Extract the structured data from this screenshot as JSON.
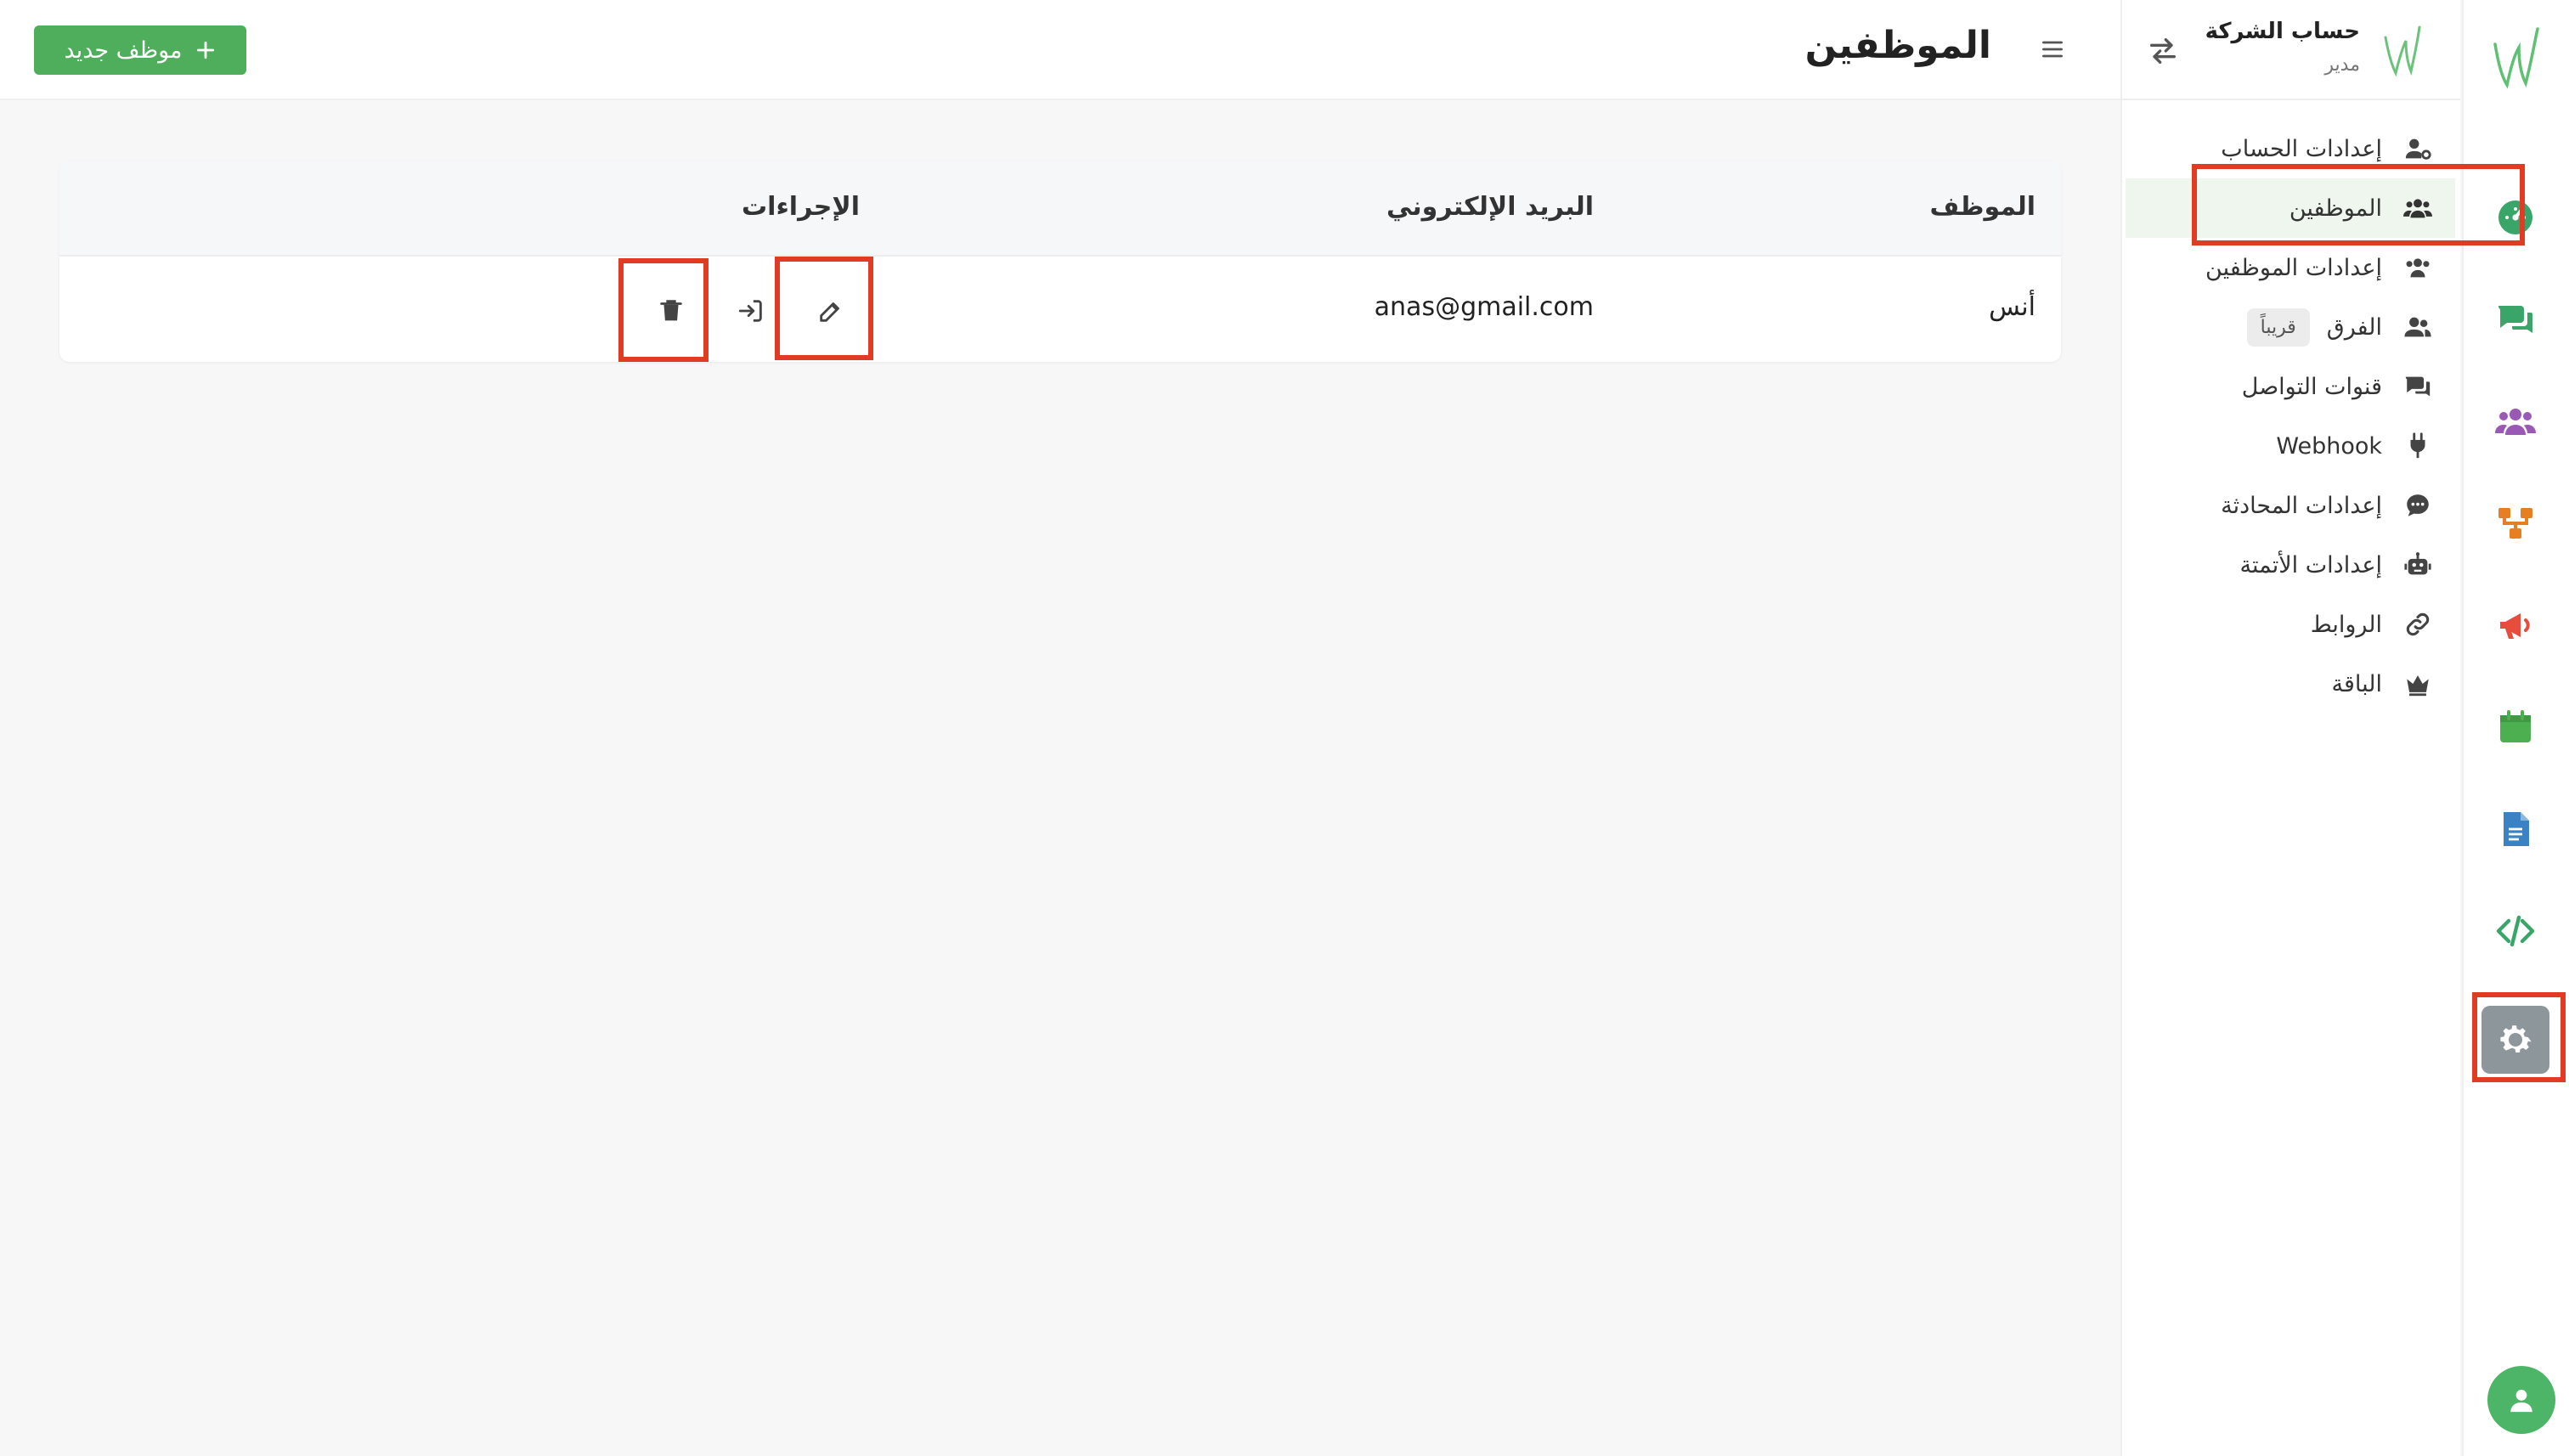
{
  "topbar": {
    "title": "الموظفين",
    "new_button": "موظف جديد"
  },
  "company": {
    "name": "حساب الشركة",
    "role": "مدير"
  },
  "sidebar": {
    "items": [
      {
        "label": "إعدادات الحساب",
        "icon": "user-gear-icon"
      },
      {
        "label": "الموظفين",
        "icon": "users-icon",
        "active": true
      },
      {
        "label": "إعدادات الموظفين",
        "icon": "users-cog-icon"
      },
      {
        "label": "الفرق",
        "icon": "user-group-icon",
        "badge": "قريباً"
      },
      {
        "label": "قنوات التواصل",
        "icon": "comments-icon"
      },
      {
        "label": "Webhook",
        "icon": "plug-icon"
      },
      {
        "label": "إعدادات المحادثة",
        "icon": "comment-dots-icon"
      },
      {
        "label": "إعدادات الأتمتة",
        "icon": "robot-icon"
      },
      {
        "label": "الروابط",
        "icon": "link-icon"
      },
      {
        "label": "الباقة",
        "icon": "crown-icon"
      }
    ]
  },
  "rail": {
    "items": [
      {
        "icon": "dashboard-icon",
        "color": "#3aa569"
      },
      {
        "icon": "chat-icon",
        "color": "#3aa569"
      },
      {
        "icon": "team-icon",
        "color": "#9b59b6"
      },
      {
        "icon": "flow-icon",
        "color": "#e67e22"
      },
      {
        "icon": "megaphone-icon",
        "color": "#e74c3c"
      },
      {
        "icon": "calendar-icon",
        "color": "#4caf50"
      },
      {
        "icon": "document-icon",
        "color": "#3b82c4"
      },
      {
        "icon": "code-icon",
        "color": "#3aa569"
      },
      {
        "icon": "settings-icon",
        "color": "#ffffff",
        "active": true
      }
    ]
  },
  "table": {
    "headers": {
      "employee": "الموظف",
      "email": "البريد الإلكتروني",
      "actions": "الإجراءات"
    },
    "rows": [
      {
        "employee": "أنس",
        "email": "anas@gmail.com"
      }
    ]
  },
  "colors": {
    "accent_green": "#4fae5c",
    "highlight_red": "#e13b24"
  }
}
